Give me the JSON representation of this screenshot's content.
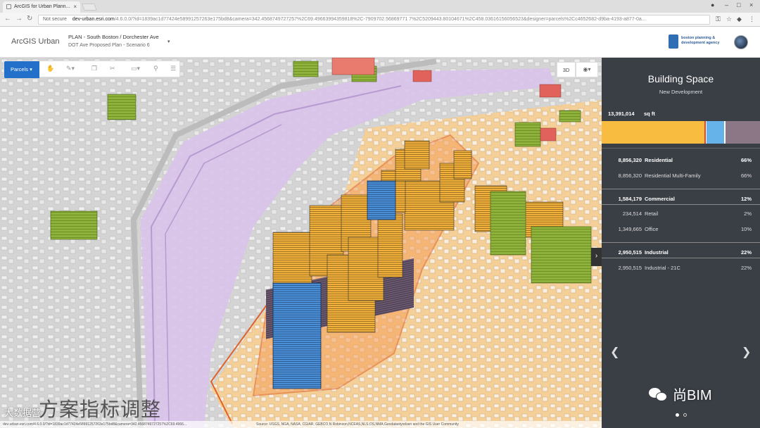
{
  "browser": {
    "tab_title": "ArcGIS for Urban Plann...",
    "security_label": "Not secure",
    "url_host": "dev-urban.esri.com",
    "url_path": "/4.6.0.0/?id=1839ac1d77424e58991257263e175bd8&camera=342.4568749727257%2C69.49663994359818%2C-7909702.56869771 7%2C5209443.80104671%2C458.03616156056523&designer=parcels%2Cc4652682-d9ba-4193-a877-0a..."
  },
  "header": {
    "brand": "ArcGIS Urban",
    "plan_title": "PLAN - South Boston / Dorchester Ave",
    "plan_scenario": "DOT Ave Proposed Plan - Scenario 6",
    "agency_name": "boston planning & development agency"
  },
  "toolbar": {
    "parcels_label": "Parcels ▾",
    "view_3d_label": "3D"
  },
  "panel": {
    "title": "Building Space",
    "subtitle": "New Development",
    "total_value": "13,391,014",
    "total_unit": "sq ft",
    "colors": {
      "residential": "#f8bd40",
      "commercial": "#66b3ea",
      "industrial": "#8c7786"
    },
    "segments": [
      {
        "name": "residential",
        "fraction": 0.66
      },
      {
        "name": "commercial",
        "fraction": 0.12
      },
      {
        "name": "industrial",
        "fraction": 0.22
      }
    ],
    "rows": [
      {
        "kind": "cat",
        "value": "8,856,320",
        "name": "Residential",
        "pct": "66%"
      },
      {
        "kind": "sub",
        "value": "8,856,320",
        "name": "Residential Multi-Family",
        "pct": "66%"
      },
      {
        "kind": "cat",
        "value": "1,584,179",
        "name": "Commercial",
        "pct": "12%"
      },
      {
        "kind": "sub",
        "value": "234,514",
        "name": "Retail",
        "pct": "2%"
      },
      {
        "kind": "sub",
        "value": "1,349,665",
        "name": "Office",
        "pct": "10%"
      },
      {
        "kind": "cat",
        "value": "2,950,515",
        "name": "Industrial",
        "pct": "22%"
      },
      {
        "kind": "sub",
        "value": "2,950,515",
        "name": "Industrial - 21C",
        "pct": "22%"
      }
    ]
  },
  "map": {
    "caption": "方案指标调整",
    "footer_url": "dev-urban.esri.com/4.6.0.0/?id=1839ac1d77424e58991257263e175bd8&camera=342.4568749727257%2C69.4966...",
    "footer_credit": "Source: USGS, NGA, NASA, CGIAR, GEBCO,N Robinson,NCEAS,NLS,OS,NMA,Geodatastyrelsen and the GIS User Community"
  },
  "watermarks": {
    "left": "大数据营",
    "right": "尚BIM"
  }
}
